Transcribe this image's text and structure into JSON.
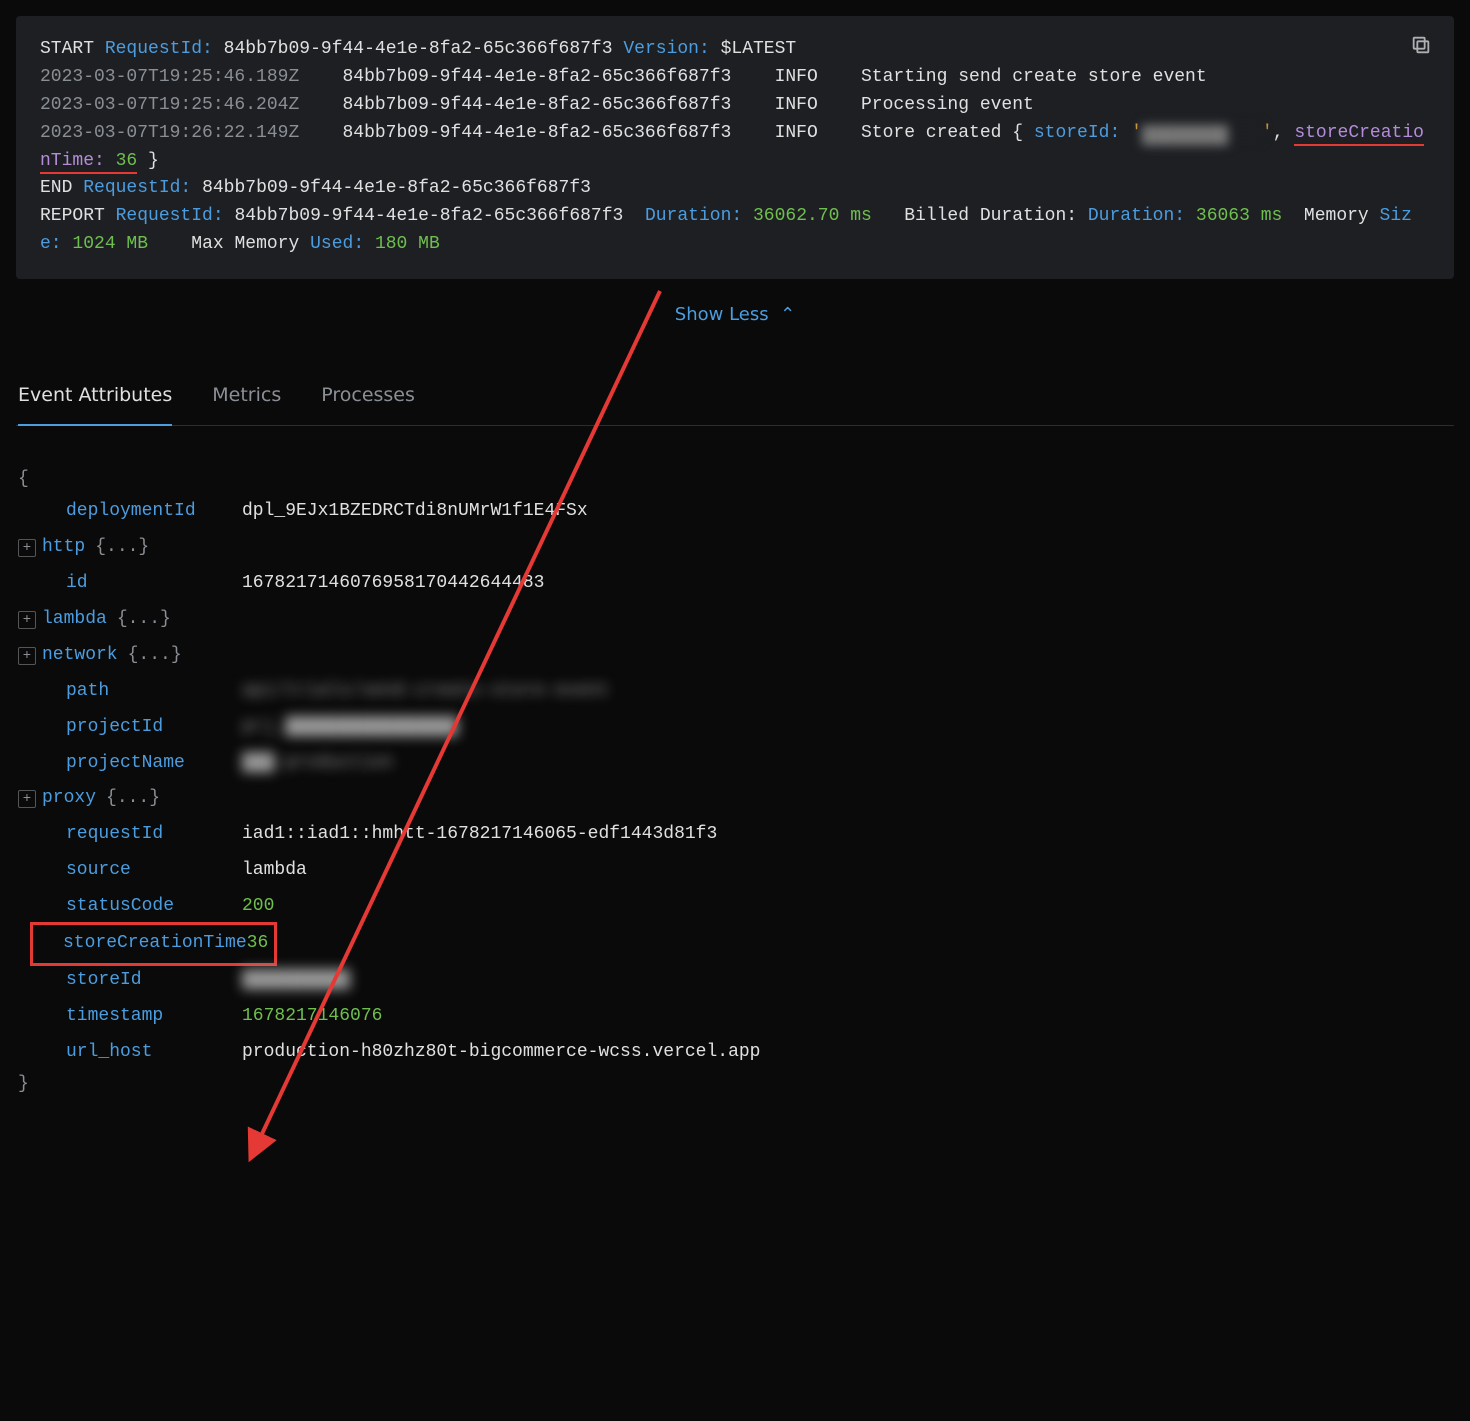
{
  "log": {
    "start_kw": "START",
    "request_kw": "RequestId:",
    "request_id": "84bb7b09-9f44-4e1e-8fa2-65c366f687f3",
    "version_kw": "Version:",
    "version_val": "$LATEST",
    "line1_ts": "2023-03-07T19:25:46.189Z",
    "line1_level": "INFO",
    "line1_msg": "Starting send create store event",
    "line2_ts": "2023-03-07T19:25:46.204Z",
    "line2_level": "INFO",
    "line2_msg": "Processing event",
    "line3_ts": "2023-03-07T19:26:22.149Z",
    "line3_level": "INFO",
    "line3_msg_a": "Store created {",
    "line3_storeid_key": "storeId:",
    "line3_storeid_val": "'██████████'",
    "line3_sct_key": "storeCreationTime:",
    "line3_sct_val": "36",
    "line3_msg_b": "}",
    "end_kw": "END",
    "report_kw": "REPORT",
    "dur_kw": "Duration:",
    "dur_val": "36062.70 ms",
    "billed_kw": "Billed Duration:",
    "billed_val": "36063 ms",
    "mem_kw": "Memory",
    "size_kw": "Size:",
    "size_val": "1024 MB",
    "maxmem_kw": "Max Memory",
    "used_kw": "Used:",
    "used_val": "180 MB"
  },
  "show_less": "Show Less",
  "tabs": {
    "attrs": "Event Attributes",
    "metrics": "Metrics",
    "processes": "Processes"
  },
  "attrs": {
    "open": "{",
    "close": "}",
    "obj": "{...}",
    "deploymentId_k": "deploymentId",
    "deploymentId_v": "dpl_9EJx1BZEDRCTdi8nUMrW1f1E4FSx",
    "http_k": "http",
    "id_k": "id",
    "id_v": "16782171460769581704426444​83",
    "lambda_k": "lambda",
    "network_k": "network",
    "path_k": "path",
    "path_v": "api/trials/send-create-store-event",
    "projectId_k": "projectId",
    "projectId_v": "prj_████████████████",
    "projectName_k": "projectName",
    "projectName_v": "███-production",
    "proxy_k": "proxy",
    "requestId_k": "requestId",
    "requestId_v": "iad1::iad1::hmhtt-1678217146065-edf1443d81f3",
    "source_k": "source",
    "source_v": "lambda",
    "statusCode_k": "statusCode",
    "statusCode_v": "200",
    "storeCreationTime_k": "storeCreationTime",
    "storeCreationTime_v": "36",
    "storeId_k": "storeId",
    "storeId_v": "██████████",
    "timestamp_k": "timestamp",
    "timestamp_v": "1678217146076",
    "url_host_k": "url_host",
    "url_host_v": "production-h80zhz80t-bigcommerce-wcss.vercel.app"
  }
}
